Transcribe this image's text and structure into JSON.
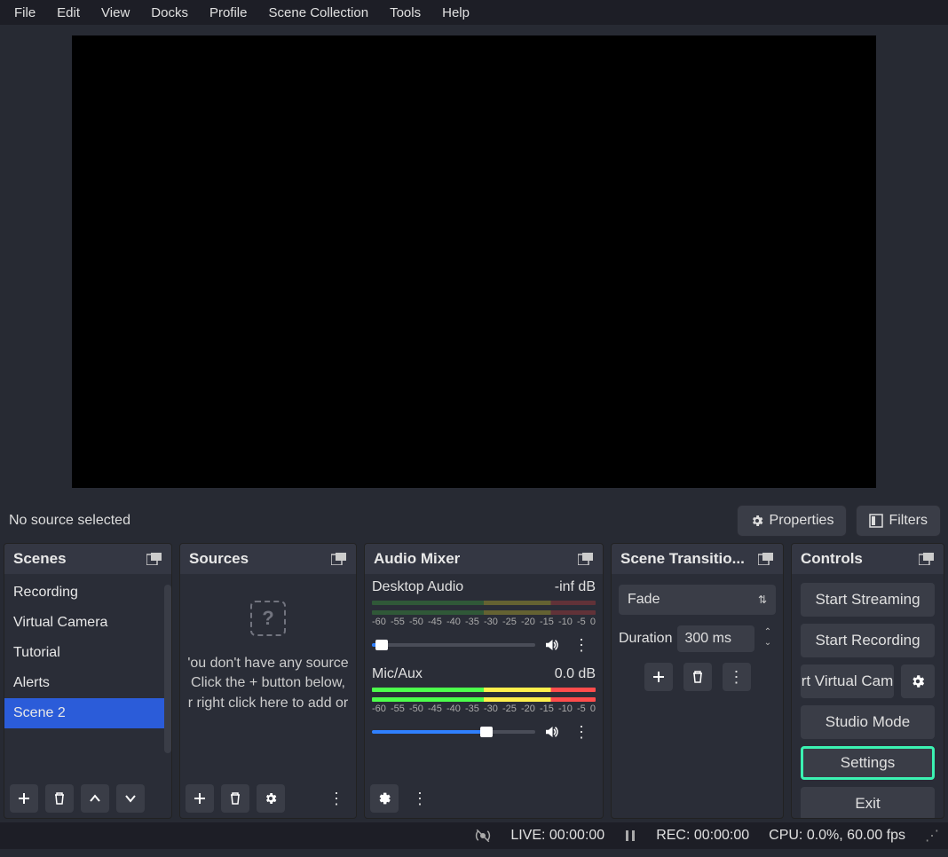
{
  "menu": [
    "File",
    "Edit",
    "View",
    "Docks",
    "Profile",
    "Scene Collection",
    "Tools",
    "Help"
  ],
  "toolbar": {
    "status": "No source selected",
    "properties": "Properties",
    "filters": "Filters"
  },
  "scenes": {
    "title": "Scenes",
    "items": [
      "Recording",
      "Virtual Camera",
      "Tutorial",
      "Alerts",
      "Scene 2"
    ],
    "selected": 4
  },
  "sources": {
    "title": "Sources",
    "empty_l1": "'ou don't have any source",
    "empty_l2": "Click the + button below,",
    "empty_l3": "r right click here to add or"
  },
  "mixer": {
    "title": "Audio Mixer",
    "ticks": [
      "-60",
      "-55",
      "-50",
      "-45",
      "-40",
      "-35",
      "-30",
      "-25",
      "-20",
      "-15",
      "-10",
      "-5",
      "0"
    ],
    "tracks": [
      {
        "name": "Desktop Audio",
        "db": "-inf dB",
        "fill": 6
      },
      {
        "name": "Mic/Aux",
        "db": "0.0 dB",
        "fill": 70
      }
    ]
  },
  "transitions": {
    "title": "Scene Transitio...",
    "selected": "Fade",
    "duration_label": "Duration",
    "duration_value": "300 ms"
  },
  "controls": {
    "title": "Controls",
    "start_stream": "Start Streaming",
    "start_rec": "Start Recording",
    "virtual_cam": "rt Virtual Cam",
    "studio": "Studio Mode",
    "settings": "Settings",
    "exit": "Exit"
  },
  "status": {
    "live": "LIVE: 00:00:00",
    "rec": "REC: 00:00:00",
    "cpu": "CPU: 0.0%, 60.00 fps"
  }
}
